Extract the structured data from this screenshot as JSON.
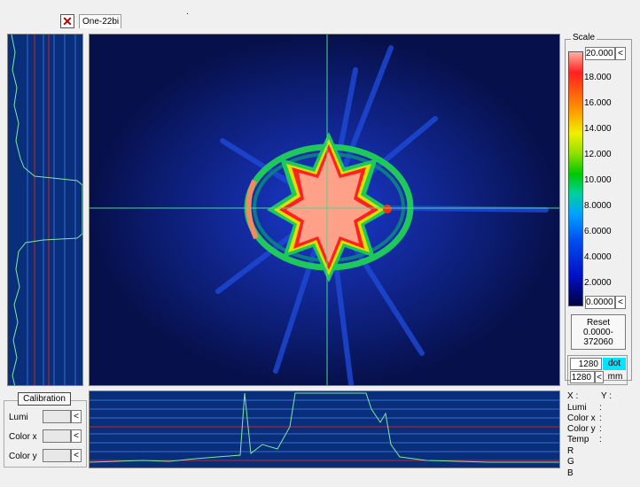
{
  "tab": {
    "title": "One-22bi",
    "close_symbol": "✕",
    "dot_mark": "."
  },
  "scale": {
    "title": "Scale",
    "max_value": "20.000",
    "min_value": "0.0000",
    "arrow": "<",
    "ticks": [
      "18.000",
      "16.000",
      "14.000",
      "12.000",
      "10.000",
      "8.0000",
      "6.0000",
      "4.0000",
      "2.0000"
    ]
  },
  "reset": {
    "label": "Reset",
    "range_line1": "0.0000-",
    "range_line2": "372060"
  },
  "resolution": {
    "value1": "1280",
    "unit1": "dot",
    "value2": "1280",
    "arrow": "<",
    "unit2": "mm"
  },
  "calibration": {
    "button_label": "Calibration",
    "rows": [
      {
        "label": "Lumi",
        "arrow": "<"
      },
      {
        "label": "Color x",
        "arrow": "<"
      },
      {
        "label": "Color y",
        "arrow": "<"
      }
    ]
  },
  "readout": {
    "x_label": "X :",
    "y_label": "Y :",
    "rows": [
      "Lumi",
      "Color x",
      "Color y",
      "Temp",
      "R",
      "G",
      "B"
    ],
    "colons": [
      ":",
      ":",
      ":",
      ":"
    ]
  },
  "colors": {
    "accent_cyan": "#00e5ff",
    "profile_bg": "#0a2f7a",
    "image_bg": "#06104a",
    "trace": "#7fe8a0"
  }
}
